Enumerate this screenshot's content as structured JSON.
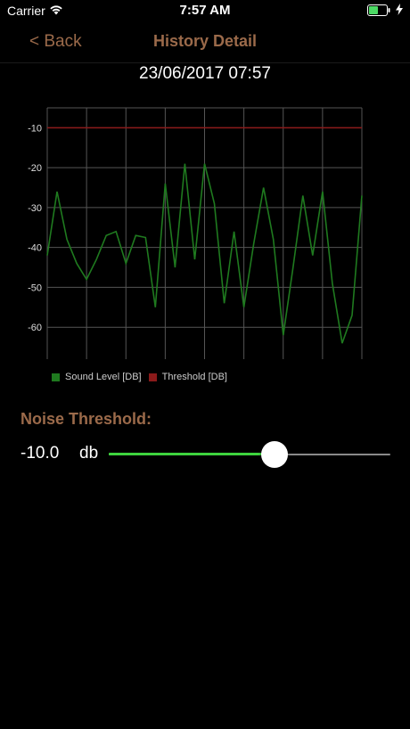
{
  "status_bar": {
    "carrier": "Carrier",
    "time": "7:57 AM",
    "wifi_icon": "wifi-icon",
    "battery_icon": "battery-icon",
    "battery_color": "#4cd964"
  },
  "nav": {
    "back_label": "< Back",
    "title": "History Detail",
    "accent_color": "#9b6a4a"
  },
  "record": {
    "datetime": "23/06/2017 07:57"
  },
  "chart_data": {
    "type": "line",
    "ylim": [
      -68,
      -5
    ],
    "yticks": [
      -10,
      -20,
      -30,
      -40,
      -50,
      -60
    ],
    "ytick_labels": [
      "-10",
      "-20",
      "-30",
      "-40",
      "-50",
      "-60"
    ],
    "grid": true,
    "legend_position": "bottom-left",
    "series": [
      {
        "name": "Sound Level [DB]",
        "color": "#1f7a1f",
        "values": [
          -42,
          -26,
          -38,
          -44,
          -48,
          -43,
          -37,
          -36,
          -44,
          -37,
          -37.5,
          -55,
          -24,
          -45,
          -19,
          -43,
          -19,
          -29,
          -54,
          -36,
          -55,
          -39,
          -25,
          -38,
          -62,
          -45,
          -27,
          -42,
          -26,
          -49,
          -64,
          -57,
          -27
        ]
      },
      {
        "name": "Threshold [DB]",
        "color": "#8b1a1a",
        "values": [
          -10,
          -10
        ]
      }
    ]
  },
  "threshold": {
    "heading": "Noise Threshold:",
    "value_text": "-10.0",
    "unit": "db",
    "slider_fraction": 0.59,
    "fill_color": "#3ed43e"
  }
}
